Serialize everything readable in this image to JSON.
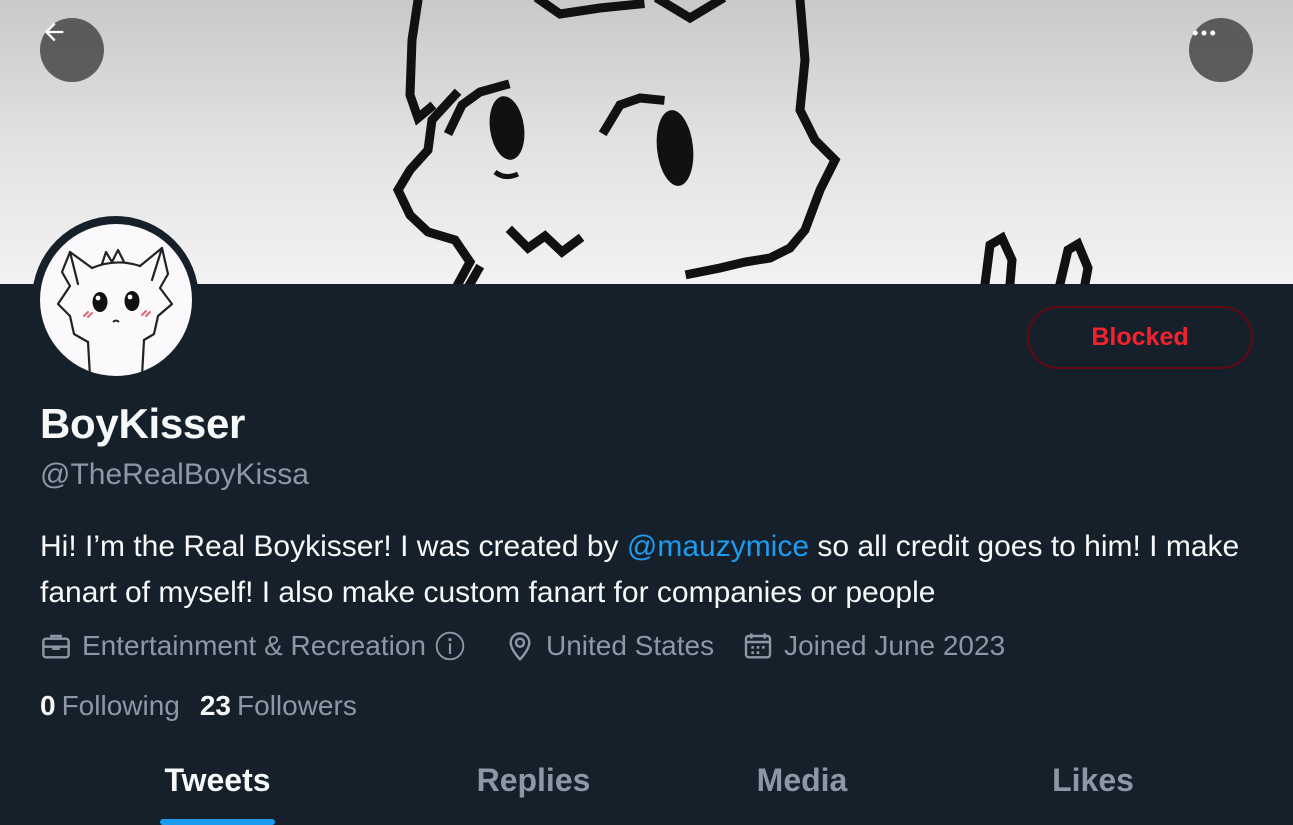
{
  "header": {
    "back_icon": "arrow-left-icon",
    "more_icon": "more-horizontal-icon"
  },
  "profile": {
    "display_name": "BoyKisser",
    "handle": "@TheRealBoyKissa",
    "bio": {
      "before_mention": "Hi! I’m the Real Boykisser! I was created by ",
      "mention": "@mauzymice",
      "after_mention": " so all credit goes to him! I make fanart of myself! I also make custom fanart for companies or people"
    },
    "category": "Entertainment & Recreation",
    "location": "United States",
    "joined": "Joined June 2023",
    "following_count": "0",
    "following_label": "Following",
    "followers_count": "23",
    "followers_label": "Followers",
    "block_button_label": "Blocked"
  },
  "tabs": [
    {
      "label": "Tweets",
      "active": true
    },
    {
      "label": "Replies",
      "active": false
    },
    {
      "label": "Media",
      "active": false
    },
    {
      "label": "Likes",
      "active": false
    }
  ],
  "colors": {
    "background": "#15202b",
    "accent": "#1d9bf0",
    "secondary_text": "#8b98a5",
    "danger": "#f4212e"
  }
}
